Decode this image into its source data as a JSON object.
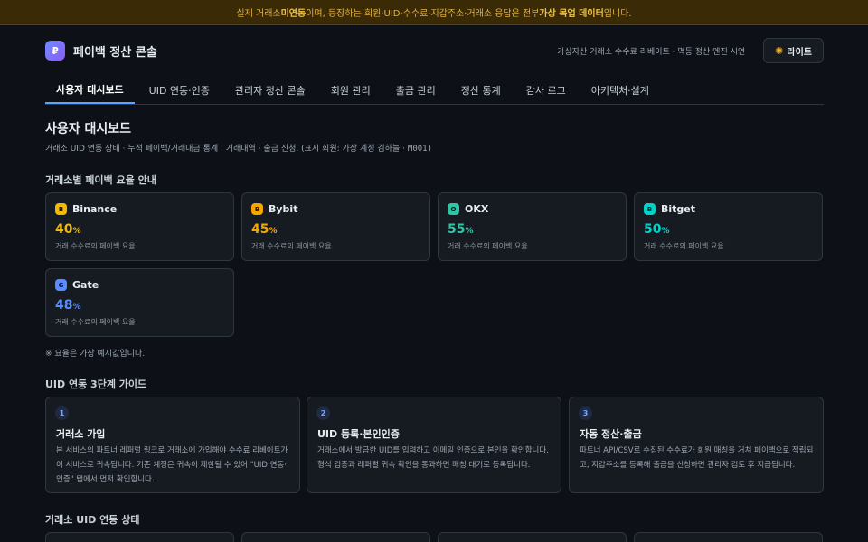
{
  "banner": {
    "prefix": "실제 거래소 ",
    "highlight1": "미연동",
    "middle": "이며, 등장하는 회원·UID·수수료·지갑주소·거래소 응답은 전부 ",
    "highlight2": "가상 목업 데이터",
    "suffix": "입니다."
  },
  "header": {
    "logo_glyph": "₽",
    "title": "페이백 정산 콘솔",
    "tagline": "가상자산 거래소 수수료 리베이트 · 멱등 정산 엔진 시연",
    "theme_icon": "sun-icon",
    "theme_label": "라이트"
  },
  "tabs": [
    {
      "label": "사용자 대시보드",
      "active": true
    },
    {
      "label": "UID 연동·인증",
      "active": false
    },
    {
      "label": "관리자 정산 콘솔",
      "active": false
    },
    {
      "label": "회원 관리",
      "active": false
    },
    {
      "label": "출금 관리",
      "active": false
    },
    {
      "label": "정산 통계",
      "active": false
    },
    {
      "label": "감사 로그",
      "active": false
    },
    {
      "label": "아키텍처·설계",
      "active": false
    }
  ],
  "page": {
    "title": "사용자 대시보드",
    "subtitle": "거래소 UID 연동 상태 · 누적 페이백/거래대금 통계 · 거래내역 · 출금 신청. (표시 회원: 가상 계정 김하늘 ·",
    "member_id": "M001)"
  },
  "rates_section": {
    "title": "거래소별 페이백 요율 안내",
    "note": "※ 요율은 가상 예시값입니다.",
    "exchanges": [
      {
        "initial": "B",
        "name": "Binance",
        "rate": "40",
        "unit": "%",
        "desc": "거래 수수료의 페이백 요율",
        "color": "#f0b90b"
      },
      {
        "initial": "B",
        "name": "Bybit",
        "rate": "45",
        "unit": "%",
        "desc": "거래 수수료의 페이백 요율",
        "color": "#f7a600"
      },
      {
        "initial": "O",
        "name": "OKX",
        "rate": "55",
        "unit": "%",
        "desc": "거래 수수료의 페이백 요율",
        "color": "#2ec4a5"
      },
      {
        "initial": "B",
        "name": "Bitget",
        "rate": "50",
        "unit": "%",
        "desc": "거래 수수료의 페이백 요율",
        "color": "#00d4c8"
      },
      {
        "initial": "G",
        "name": "Gate",
        "rate": "48",
        "unit": "%",
        "desc": "거래 수수료의 페이백 요율",
        "color": "#5b8cff"
      }
    ]
  },
  "guide_section": {
    "title": "UID 연동 3단계 가이드",
    "steps": [
      {
        "num": "1",
        "title": "거래소 가입",
        "body": "본 서비스의 파트너 레퍼럴 링크로 거래소에 가입해야 수수료 리베이트가 이 서비스로 귀속됩니다. 기존 계정은 귀속이 제한될 수 있어 \"UID 연동·인증\" 탭에서 먼저 확인합니다."
      },
      {
        "num": "2",
        "title": "UID 등록·본인인증",
        "body": "거래소에서 발급한 UID를 입력하고 이메일 인증으로 본인을 확인합니다. 형식 검증과 레퍼럴 귀속 확인을 통과하면 매칭 대기로 등록됩니다."
      },
      {
        "num": "3",
        "title": "자동 정산·출금",
        "body": "파트너 API/CSV로 수집된 수수료가 회원 매칭을 거쳐 페이백으로 적립되고, 지갑주소를 등록해 출금을 신청하면 관리자 검토 후 지급됩니다."
      }
    ]
  },
  "status_section": {
    "title": "거래소 UID 연동 상태"
  }
}
